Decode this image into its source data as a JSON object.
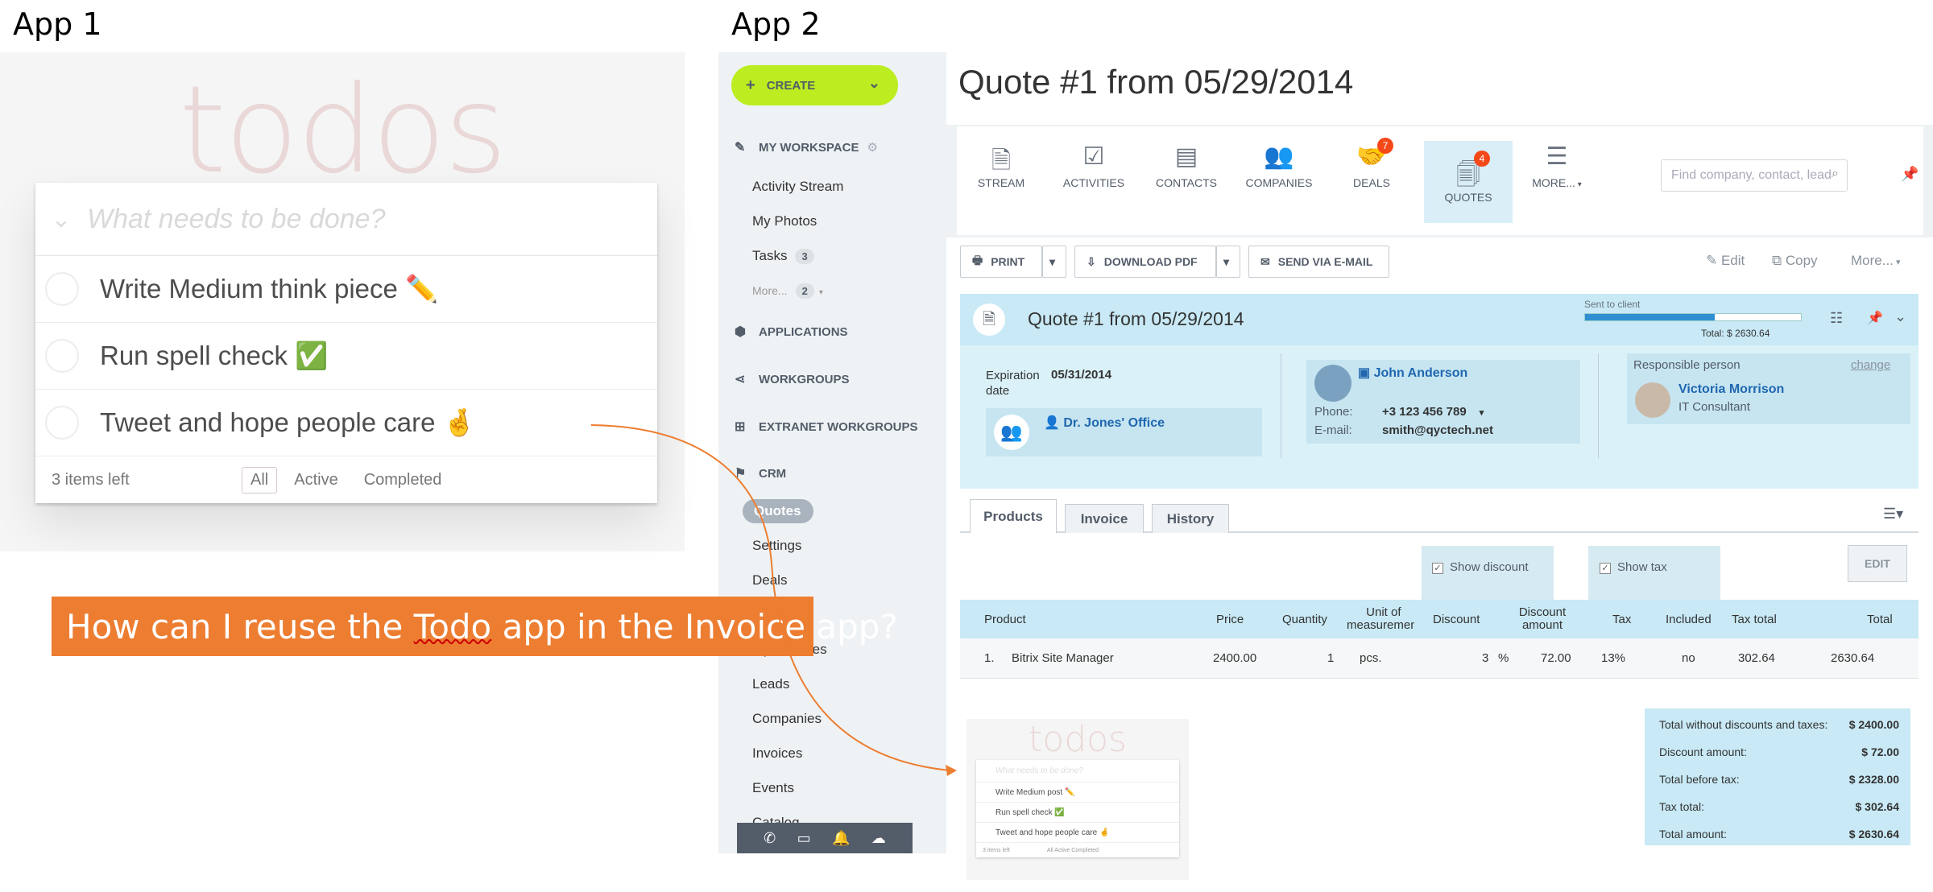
{
  "labels": {
    "app1": "App 1",
    "app2": "App 2"
  },
  "todo": {
    "title": "todos",
    "placeholder": "What needs to be done?",
    "items": [
      "Write Medium think piece ✏️",
      "Run spell check ✅",
      "Tweet and hope people care 🤞"
    ],
    "items_left": "3 items left",
    "filters": [
      "All",
      "Active",
      "Completed"
    ]
  },
  "banner": {
    "before": "How can I reuse the ",
    "underlined": "Todo",
    "after": " app in the Invoice app?"
  },
  "crm": {
    "create_label": "CREATE",
    "sections": {
      "workspace": "MY WORKSPACE",
      "applications": "APPLICATIONS",
      "workgroups": "WORKGROUPS",
      "extranet": "EXTRANET WORKGROUPS",
      "crm": "CRM"
    },
    "workspace_items": {
      "activity": "Activity Stream",
      "photos": "My Photos",
      "tasks": "Tasks",
      "tasks_count": "3",
      "more": "More...",
      "more_count": "2"
    },
    "crm_items": {
      "quotes": "Quotes",
      "settings": "Settings",
      "deals": "Deals",
      "partial": "...y activities",
      "leads": "Leads",
      "companies": "Companies",
      "invoices": "Invoices",
      "events": "Events",
      "catalog": "Catalog"
    },
    "page_title": "Quote #1 from 05/29/2014",
    "nav": [
      {
        "label": "STREAM",
        "icon": "📄"
      },
      {
        "label": "ACTIVITIES",
        "icon": "📋"
      },
      {
        "label": "CONTACTS",
        "icon": "📇"
      },
      {
        "label": "COMPANIES",
        "icon": "👥"
      },
      {
        "label": "DEALS",
        "icon": "🤝",
        "badge": "7"
      },
      {
        "label": "QUOTES",
        "icon": "📑",
        "badge": "4"
      },
      {
        "label": "MORE...",
        "icon": "☰"
      }
    ],
    "search_placeholder": "Find company, contact, lead",
    "toolbar": {
      "print": "PRINT",
      "download": "DOWNLOAD PDF",
      "email": "SEND VIA E-MAIL",
      "edit": "Edit",
      "copy": "Copy",
      "more": "More..."
    },
    "card": {
      "title": "Quote #1 from 05/29/2014",
      "sent_label": "Sent to client",
      "total": "Total: $ 2630.64",
      "sent_progress": 0.6,
      "expiration_label": "Expiration date",
      "expiration_value": "05/31/2014",
      "company": "Dr. Jones' Office",
      "contact_name": "John Anderson",
      "phone_label": "Phone:",
      "phone": "+3 123 456 789",
      "email_label": "E-mail:",
      "email": "smith@qyctech.net",
      "responsible_label": "Responsible person",
      "change": "change",
      "responsible_name": "Victoria Morrison",
      "responsible_title": "IT Consultant"
    },
    "tabs": [
      "Products",
      "Invoice",
      "History"
    ],
    "show_discount": "Show discount",
    "show_tax": "Show tax",
    "edit_button": "EDIT",
    "table": {
      "headers": [
        "Product",
        "Price",
        "Quantity",
        "Unit of measurement",
        "Discount",
        "Discount amount",
        "Tax",
        "Included",
        "Tax total",
        "Total"
      ],
      "row": {
        "num": "1.",
        "product": "Bitrix Site Manager",
        "price": "2400.00",
        "quantity": "1",
        "unit": "pcs.",
        "discount": "3",
        "discount_unit": "%",
        "discount_amount": "72.00",
        "tax": "13%",
        "included": "no",
        "tax_total": "302.64",
        "total": "2630.64"
      }
    },
    "totals": [
      {
        "label": "Total without discounts and taxes:",
        "value": "$ 2400.00"
      },
      {
        "label": "Discount amount:",
        "value": "$ 72.00"
      },
      {
        "label": "Total before tax:",
        "value": "$ 2328.00"
      },
      {
        "label": "Tax total:",
        "value": "$ 302.64"
      },
      {
        "label": "Total amount:",
        "value": "$ 2630.64"
      }
    ],
    "mini_todo": {
      "title": "todos",
      "placeholder": "What needs to be done?",
      "items": [
        "Write Medium post ✏️",
        "Run spell check ✅",
        "Tweet and hope people care 🤞"
      ],
      "footer_left": "3 items left",
      "footer_filters": [
        "All",
        "Active",
        "Completed"
      ]
    }
  },
  "colors": {
    "accent_green": "#bbed21",
    "banner_orange": "#ed7d31",
    "crm_blue": "#2067b0",
    "badge_red": "#f54819"
  }
}
